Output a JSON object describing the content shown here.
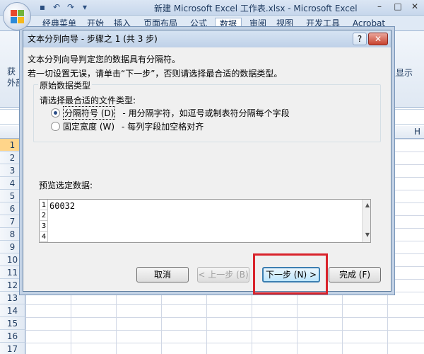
{
  "window": {
    "title": "新建 Microsoft Excel 工作表.xlsx - Microsoft Excel",
    "controls": [
      "–",
      "□",
      "✕"
    ]
  },
  "quick_access": [
    "save-icon",
    "undo-icon",
    "redo-icon",
    "customize-icon"
  ],
  "ribbon": {
    "tabs": [
      "经典菜单",
      "开始",
      "插入",
      "页面布局",
      "公式",
      "数据",
      "审阅",
      "视图",
      "开发工具",
      "Acrobat"
    ],
    "active_tab": "数据",
    "left_labels": [
      "获",
      "外部"
    ],
    "right_labels": [
      "级显示"
    ]
  },
  "sheet": {
    "columns": [
      "H"
    ],
    "rows": [
      "1",
      "2",
      "3",
      "4",
      "5",
      "6",
      "7",
      "8",
      "9",
      "10",
      "11",
      "12",
      "13",
      "14",
      "15",
      "16",
      "17"
    ],
    "selected_row": "1"
  },
  "dialog": {
    "title": "文本分列向导 - 步骤之 1 (共 3 步)",
    "help": "?",
    "close": "✕",
    "line1": "文本分列向导判定您的数据具有分隔符。",
    "line2": "若一切设置无误，请单击“下一步”，否则请选择最合适的数据类型。",
    "group_legend": "原始数据类型",
    "group_prompt": "请选择最合适的文件类型:",
    "options": [
      {
        "label": "分隔符号 (D)",
        "description": "- 用分隔字符，如逗号或制表符分隔每个字段",
        "selected": true
      },
      {
        "label": "固定宽度 (W)",
        "description": "- 每列字段加空格对齐",
        "selected": false
      }
    ],
    "preview_label": "预览选定数据:",
    "preview_rows": [
      "1",
      "2",
      "3",
      "4"
    ],
    "preview_value": "60032",
    "buttons": {
      "cancel": "取消",
      "back": "< 上一步 (B)",
      "next": "下一步 (N) >",
      "finish": "完成 (F)"
    }
  },
  "colors": {
    "highlight": "#d9232b",
    "titlebar": "#c7d7ec"
  }
}
